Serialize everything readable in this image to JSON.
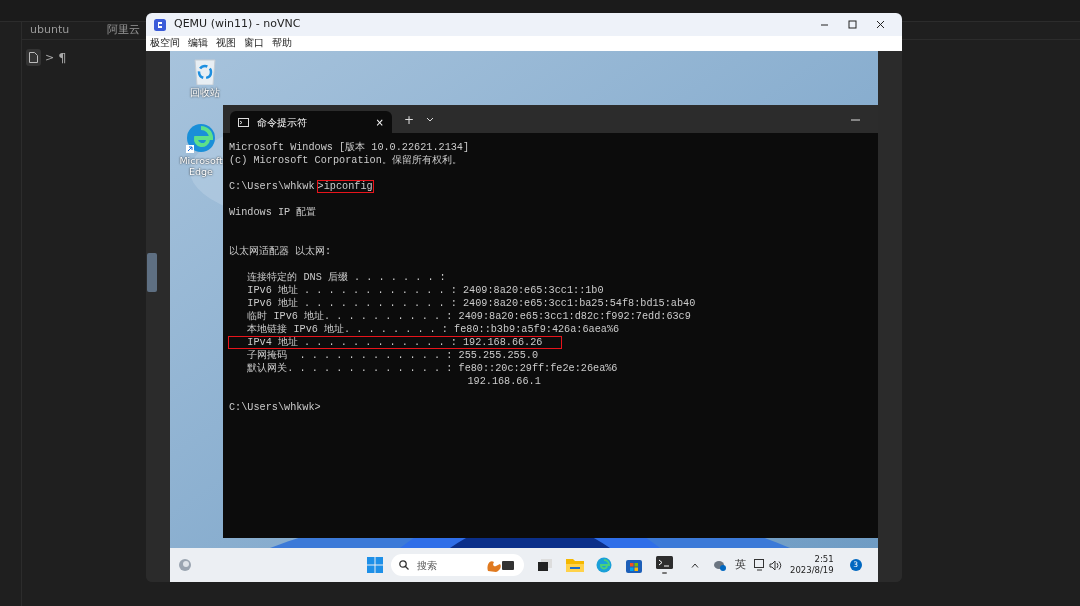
{
  "host_app": {
    "tabs": [
      {
        "label": "ubuntu"
      },
      {
        "label": "阿里云"
      }
    ],
    "breadcrumb": {
      "separator": ">",
      "item": "¶"
    }
  },
  "window": {
    "title": "QEMU (win11) - noVNC",
    "menu": [
      "极空间",
      "编辑",
      "视图",
      "窗口",
      "帮助"
    ]
  },
  "desktop_icons": [
    {
      "kind": "recycle",
      "label": "回收站"
    },
    {
      "kind": "edge",
      "label": "Microsoft Edge"
    }
  ],
  "terminal": {
    "tab_title": "命令提示符",
    "tab_close": "×",
    "new_tab": "+",
    "lines": [
      {
        "kind": "text",
        "text": "Microsoft Windows [版本 10.0.22621.2134]"
      },
      {
        "kind": "text",
        "text": "(c) Microsoft Corporation。保留所有权利。"
      },
      {
        "kind": "blank"
      },
      {
        "kind": "text",
        "text": "C:\\Users\\whkwk",
        "highlight_text": ">ipconfig"
      },
      {
        "kind": "blank"
      },
      {
        "kind": "text",
        "text": "Windows IP 配置"
      },
      {
        "kind": "blank"
      },
      {
        "kind": "blank"
      },
      {
        "kind": "text",
        "text": "以太网适配器 以太网:"
      },
      {
        "kind": "blank"
      },
      {
        "kind": "text",
        "text": "   连接特定的 DNS 后缀 . . . . . . . :"
      },
      {
        "kind": "text",
        "text": "   IPv6 地址 . . . . . . . . . . . . : 2409:8a20:e65:3cc1::1b0"
      },
      {
        "kind": "text",
        "text": "   IPv6 地址 . . . . . . . . . . . . : 2409:8a20:e65:3cc1:ba25:54f8:bd15:ab40"
      },
      {
        "kind": "text",
        "text": "   临时 IPv6 地址. . . . . . . . . . : 2409:8a20:e65:3cc1:d82c:f992:7edd:63c9"
      },
      {
        "kind": "text",
        "text": "   本地链接 IPv6 地址. . . . . . . . : fe80::b3b9:a5f9:426a:6aea%6"
      },
      {
        "kind": "text",
        "highlight_text": "   IPv4 地址 . . . . . . . . . . . . : 192.168.66.26   "
      },
      {
        "kind": "text",
        "text": "   子网掩码  . . . . . . . . . . . . : 255.255.255.0"
      },
      {
        "kind": "text",
        "text": "   默认网关. . . . . . . . . . . . . : fe80::20c:29ff:fe2e:26ea%6"
      },
      {
        "kind": "text",
        "text": "                                       192.168.66.1"
      },
      {
        "kind": "blank"
      },
      {
        "kind": "text",
        "text": "C:\\Users\\whkwk>"
      }
    ]
  },
  "taskbar": {
    "search_placeholder": "搜索",
    "ime": "英",
    "time": "2:51",
    "date": "2023/8/19",
    "notification_count": "3"
  }
}
